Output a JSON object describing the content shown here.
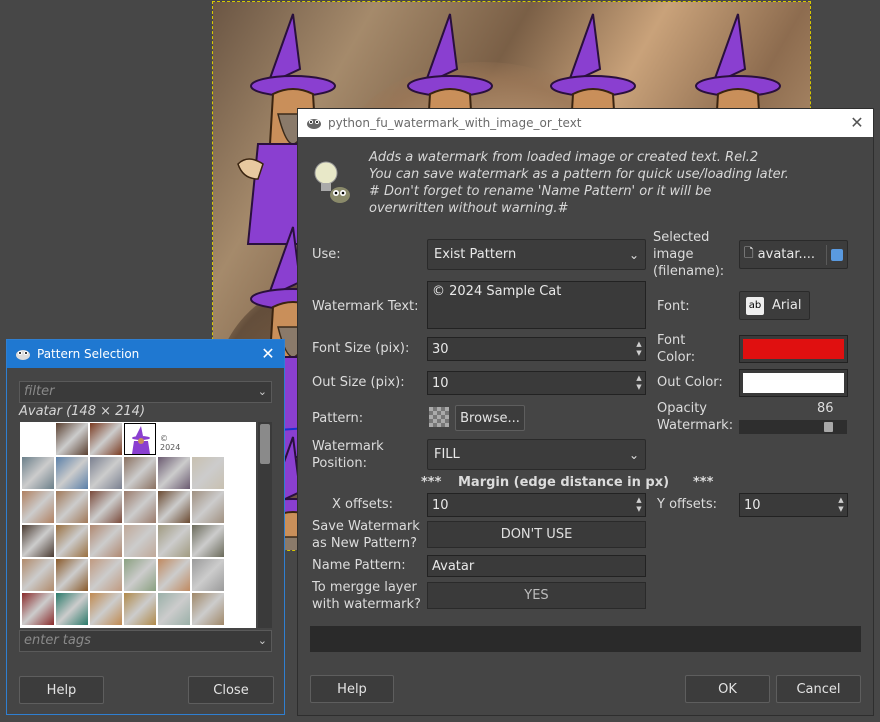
{
  "main_dialog": {
    "title": "python_fu_watermark_with_image_or_text",
    "description": [
      "Adds a watermark from loaded image or created text. Rel.2",
      "You can save watermark as a pattern for quick use/loading later.",
      "# Don't forget to rename 'Name Pattern' or it will be",
      "overwritten without warning.#"
    ],
    "use_label": "Use:",
    "use_value": "Exist Pattern",
    "selected_image_label": [
      "Selected",
      "image",
      "(filename):"
    ],
    "selected_image_value": "avatar....",
    "watermark_text_label": "Watermark Text:",
    "watermark_text_value": "© 2024 Sample Cat",
    "font_label": "Font:",
    "font_value": "Arial",
    "font_size_label": "Font Size (pix):",
    "font_size_value": "30",
    "font_color_label": [
      "Font",
      "Color:"
    ],
    "font_color": "#e01010",
    "out_size_label": "Out Size (pix):",
    "out_size_value": "10",
    "out_color_label": "Out Color:",
    "out_color": "#ffffff",
    "pattern_label": "Pattern:",
    "browse_label": "Browse...",
    "opacity_label": [
      "Opacity",
      "Watermark:"
    ],
    "opacity_value": "86",
    "opacity_fraction": 0.86,
    "position_label": [
      "Watermark",
      "Position:"
    ],
    "position_value": "FILL",
    "margin_header": [
      "***",
      "Margin (edge distance in px)",
      "***"
    ],
    "x_offsets_label": "X offsets:",
    "x_offsets_value": "10",
    "y_offsets_label": "Y offsets:",
    "y_offsets_value": "10",
    "save_label": [
      "Save Watermark",
      "as New Pattern?"
    ],
    "save_value": "DON'T USE",
    "name_pattern_label": "Name Pattern:",
    "name_pattern_value": "Avatar",
    "merge_label": [
      "To mergge layer",
      "with watermark?"
    ],
    "merge_value": "YES",
    "help_label": "Help",
    "ok_label": "OK",
    "cancel_label": "Cancel"
  },
  "pattern_dialog": {
    "title": "Pattern Selection",
    "filter_placeholder": "filter",
    "selected_pattern": "Avatar (148 × 214)",
    "tags_placeholder": "enter tags",
    "help_label": "Help",
    "close_label": "Close",
    "preview_text": "© 2024"
  },
  "icons": [
    "gimp-icon",
    "close-icon",
    "chevron-down-icon",
    "document-icon",
    "save-icon",
    "font-icon",
    "lightbulb-icon",
    "pattern-swatch-icon"
  ],
  "colors": {
    "dialog_title_active": "#1f78d1",
    "font_color": "#e01010",
    "out_color": "#ffffff",
    "arrow": "#1830d0"
  }
}
